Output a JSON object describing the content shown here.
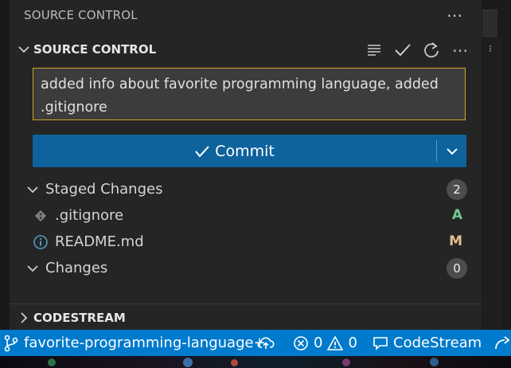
{
  "colors": {
    "accent": "#0e639c",
    "statusbar": "#007acc",
    "input_border": "#d1a524",
    "added": "#73c991",
    "modified": "#e2c08d"
  },
  "view": {
    "title": "SOURCE CONTROL",
    "more_icon": "ellipsis-icon"
  },
  "scm_section": {
    "title": "SOURCE CONTROL",
    "actions": [
      {
        "icon": "list-view-icon"
      },
      {
        "icon": "check-icon"
      },
      {
        "icon": "refresh-icon"
      },
      {
        "icon": "ellipsis-icon"
      }
    ]
  },
  "commit_message": "added info about favorite programming language, added .gitignore",
  "commit_button": {
    "label": "Commit",
    "icon": "check-icon",
    "dropdown_icon": "chevron-down-icon"
  },
  "staged": {
    "label": "Staged Changes",
    "count": "2",
    "files": [
      {
        "name": ".gitignore",
        "status": "A",
        "icon": "git-file-icon"
      },
      {
        "name": "README.md",
        "status": "M",
        "icon": "info-icon"
      }
    ]
  },
  "changes": {
    "label": "Changes",
    "count": "0"
  },
  "codestream_section": {
    "title": "CODESTREAM"
  },
  "statusbar": {
    "branch": "favorite-programming-language+",
    "errors": "0",
    "warnings": "0",
    "codestream": "CodeStream"
  }
}
